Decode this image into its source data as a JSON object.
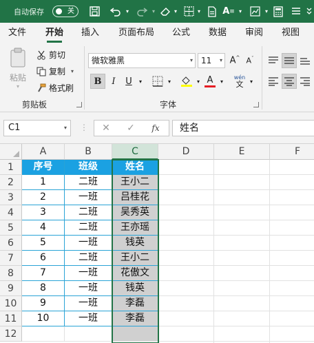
{
  "titlebar": {
    "autosave_label": "自动保存",
    "autosave_state": "关"
  },
  "ribbon_tabs": [
    "文件",
    "开始",
    "插入",
    "页面布局",
    "公式",
    "数据",
    "审阅",
    "视图"
  ],
  "clipboard": {
    "paste": "粘贴",
    "cut": "剪切",
    "copy": "复制",
    "format_painter": "格式刷",
    "group_label": "剪贴板"
  },
  "font": {
    "name": "微软雅黑",
    "size": "11",
    "bold": "B",
    "italic": "I",
    "underline": "U",
    "wen": "wén",
    "group_label": "字体"
  },
  "formula_bar": {
    "name_box": "C1",
    "fx": "fx",
    "formula": "姓名"
  },
  "grid": {
    "columns": [
      "A",
      "B",
      "C",
      "D",
      "E",
      "F"
    ],
    "rows": [
      "1",
      "2",
      "3",
      "4",
      "5",
      "6",
      "7",
      "8",
      "9",
      "10",
      "11",
      "12"
    ],
    "header_row": [
      "序号",
      "班级",
      "姓名"
    ],
    "data_rows": [
      [
        "1",
        "二班",
        "王小二"
      ],
      [
        "2",
        "一班",
        "吕桂花"
      ],
      [
        "3",
        "二班",
        "吴秀英"
      ],
      [
        "4",
        "二班",
        "王亦瑶"
      ],
      [
        "5",
        "一班",
        "钱英"
      ],
      [
        "6",
        "二班",
        "王小二"
      ],
      [
        "7",
        "一班",
        "花傲文"
      ],
      [
        "8",
        "一班",
        "钱英"
      ],
      [
        "9",
        "一班",
        "李磊"
      ],
      [
        "10",
        "一班",
        "李磊"
      ]
    ]
  },
  "colors": {
    "excel_green": "#217346",
    "header_fill": "#1ba1e2",
    "name_col_fill": "#d0d0d0",
    "table_border": "#29a3d6"
  }
}
